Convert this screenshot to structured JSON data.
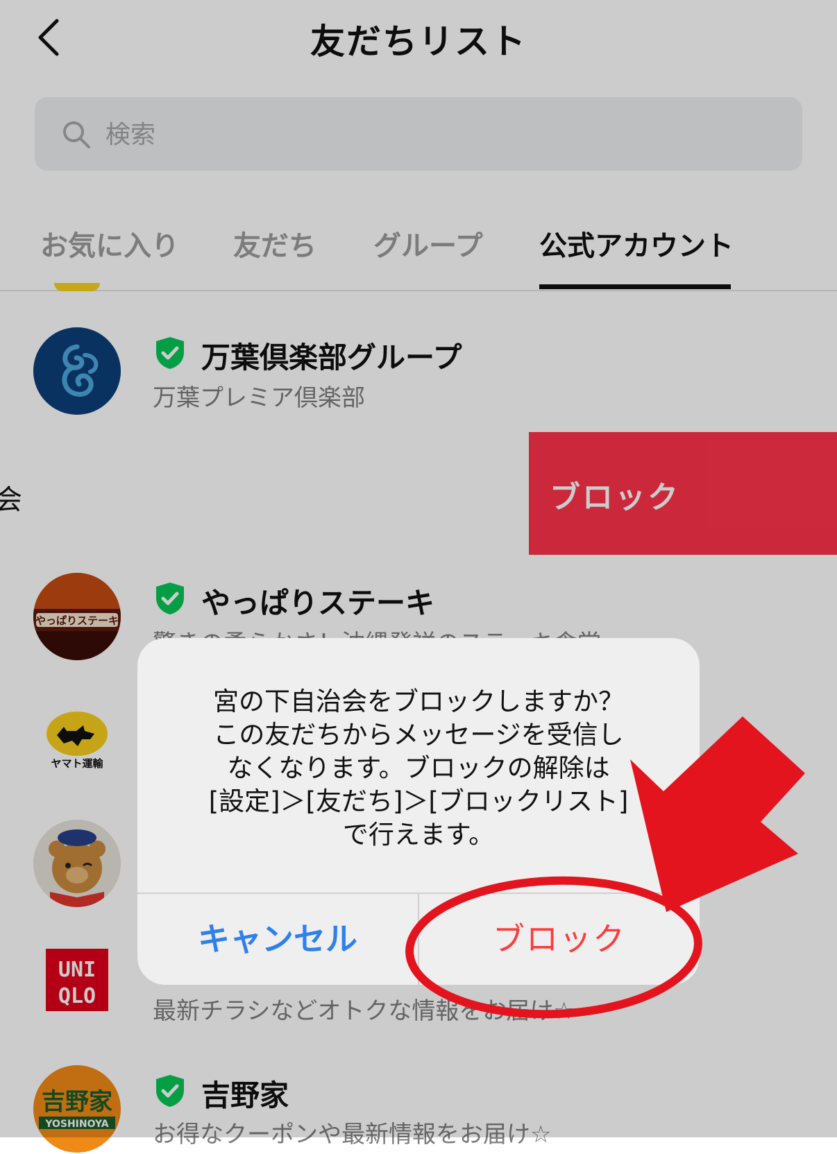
{
  "header": {
    "title": "友だちリスト",
    "back_icon": "chevron-left-icon"
  },
  "search": {
    "placeholder": "検索",
    "icon": "search-icon"
  },
  "tabs": [
    {
      "label": "お気に入り",
      "active": false
    },
    {
      "label": "友だち",
      "active": false
    },
    {
      "label": "グループ",
      "active": false
    },
    {
      "label": "公式アカウント",
      "active": true
    }
  ],
  "accounts": [
    {
      "name": "万葉倶楽部グループ",
      "sub": "万葉プレミア倶楽部",
      "verified": true
    },
    {
      "name": "やっぱりステーキ",
      "sub": "驚きの柔らかさ！沖縄発祥のステーキ食堂",
      "verified": true
    },
    {
      "name": "",
      "sub": "",
      "logo_text": "ヤマト運輸"
    },
    {
      "name": "",
      "sub": ""
    },
    {
      "name": "",
      "sub": "最新チラシなどオトクな情報をお届け☆",
      "logo_text": "UNI QLO"
    },
    {
      "name": "吉野家",
      "sub": "お得なクーポンや最新情報をお届け☆",
      "verified": true,
      "logo_text": "吉野家 YOSHINOYA"
    }
  ],
  "swipe": {
    "cut_text": "会",
    "action_label": "ブロック",
    "action_color": "#ff334b"
  },
  "alert": {
    "message_lines": [
      "宮の下自治会をブロックしますか？",
      "この友だちからメッセージを受信し",
      "なくなります。ブロックの解除は",
      "[設定]＞[友だち]＞[ブロックリスト]",
      "で行えます。"
    ],
    "cancel_label": "キャンセル",
    "block_label": "ブロック",
    "cancel_color": "#2f80ed",
    "block_color": "#ff3b3b"
  },
  "annotation_color": "#e3141e"
}
